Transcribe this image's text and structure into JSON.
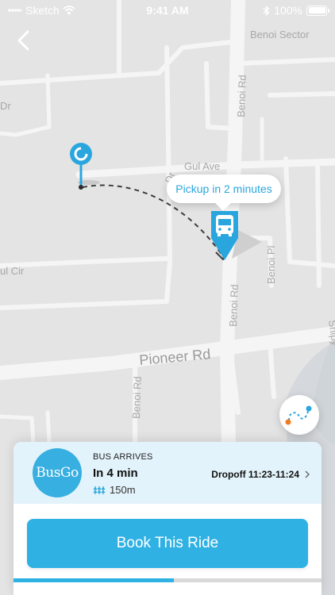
{
  "status_bar": {
    "carrier": "Sketch",
    "time": "9:41 AM",
    "battery": "100%"
  },
  "map": {
    "road_labels": {
      "benoi_sector": "Benoi Sector",
      "benoi_rd_north": "Benoi Rd",
      "benoi_rd_south": "Benoi Rd",
      "benoi_rd_lower": "Benoi Rd",
      "gul_ave": "Gul Ave",
      "pioneer_rd": "Pioneer Rd",
      "benoi_pl": "Benoi Pl",
      "gul_cir": "ul Cir",
      "dr_partial": "Dr",
      "dr_partial_2": "Dr",
      "shipy_partial": "Shipy"
    },
    "tooltip": "Pickup in 2 minutes",
    "accent_color": "#2aa6de"
  },
  "ride_card": {
    "logo_text": "BusGo",
    "arrives_label": "BUS ARRIVES",
    "arrives_time": "In 4 min",
    "walk_distance": "150m",
    "dropoff": "Dropoff 11:23-11:24",
    "book_button": "Book This Ride",
    "progress": 0.52
  },
  "icons": [
    "signal-icon",
    "wifi-icon",
    "bluetooth-icon",
    "battery-icon",
    "back-icon",
    "origin-pin-icon",
    "bus-icon",
    "route-icon",
    "walk-icon",
    "chevron-right-icon"
  ]
}
